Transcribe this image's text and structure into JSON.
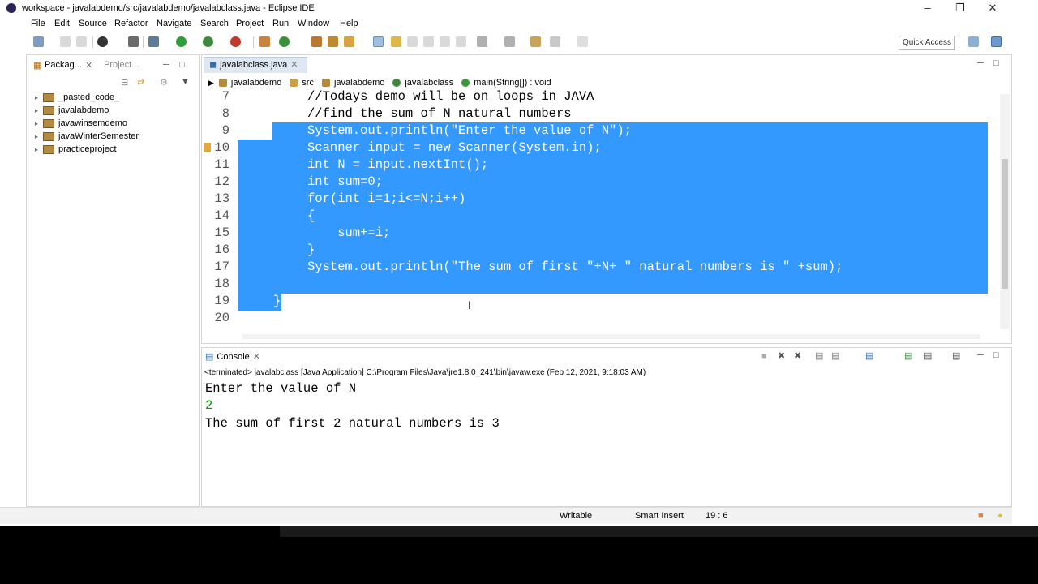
{
  "window": {
    "title": "workspace - javalabdemo/src/javalabdemo/javalabclass.java - Eclipse IDE"
  },
  "menu": [
    "File",
    "Edit",
    "Source",
    "Refactor",
    "Navigate",
    "Search",
    "Project",
    "Run",
    "Window",
    "Help"
  ],
  "toolbar": {
    "quick_access": "Quick Access"
  },
  "package_explorer": {
    "tab_label": "Packag...",
    "tab2_label": "Project...",
    "projects": [
      "_pasted_code_",
      "javalabdemo",
      "javawinsemdemo",
      "javaWinterSemester",
      "practiceproject"
    ]
  },
  "editor": {
    "tab_label": "javalabclass.java",
    "breadcrumb": [
      "javalabdemo",
      "src",
      "javalabdemo",
      "javalabclass",
      "main(String[]) : void"
    ],
    "lines": [
      {
        "num": "7",
        "text": "//Todays demo will be on loops in JAVA",
        "comment": true,
        "selected": false
      },
      {
        "num": "8",
        "text": "//find the sum of N natural numbers",
        "comment": true,
        "selected": false
      },
      {
        "num": "9",
        "text": "System.out.println(\"Enter the value of N\");",
        "comment": false,
        "selected": true
      },
      {
        "num": "10",
        "text": "Scanner input = new Scanner(System.in);",
        "comment": false,
        "selected": true
      },
      {
        "num": "11",
        "text": "int N = input.nextInt();",
        "comment": false,
        "selected": true
      },
      {
        "num": "12",
        "text": "int sum=0;",
        "comment": false,
        "selected": true
      },
      {
        "num": "13",
        "text": "for(int i=1;i<=N;i++)",
        "comment": false,
        "selected": true
      },
      {
        "num": "14",
        "text": "{",
        "comment": false,
        "selected": true
      },
      {
        "num": "15",
        "text": "    sum+=i;",
        "comment": false,
        "selected": true
      },
      {
        "num": "16",
        "text": "}",
        "comment": false,
        "selected": true
      },
      {
        "num": "17",
        "text": "System.out.println(\"The sum of first \"+N+ \" natural numbers is \" +sum);",
        "comment": false,
        "selected": true
      },
      {
        "num": "18",
        "text": "",
        "comment": false,
        "selected": true
      },
      {
        "num": "19",
        "text": "}",
        "comment": false,
        "selected": true
      },
      {
        "num": "20",
        "text": "",
        "comment": false,
        "selected": false
      }
    ]
  },
  "console": {
    "tab_label": "Console",
    "status": "<terminated> javalabclass [Java Application] C:\\Program Files\\Java\\jre1.8.0_241\\bin\\javaw.exe (Feb 12, 2021, 9:18:03 AM)",
    "output": [
      {
        "text": "Enter the value of N",
        "color": "#000000"
      },
      {
        "text": "2",
        "color": "#00a000"
      },
      {
        "text": "The sum of first 2 natural numbers is 3",
        "color": "#000000"
      }
    ]
  },
  "statusbar": {
    "writable": "Writable",
    "insert_mode": "Smart Insert",
    "position": "19 : 6"
  },
  "colors": {
    "selection": "#3399ff",
    "comment": "#3f7f5f",
    "accent": "#dfe7f3"
  }
}
